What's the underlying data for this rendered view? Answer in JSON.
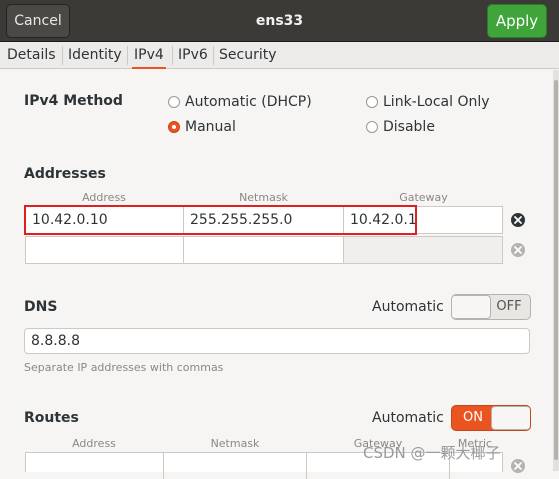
{
  "header": {
    "title": "ens33",
    "cancel_label": "Cancel",
    "apply_label": "Apply",
    "apply_color": "#3fa53a"
  },
  "tabs": [
    {
      "label": "Details",
      "active": false
    },
    {
      "label": "Identity",
      "active": false
    },
    {
      "label": "IPv4",
      "active": true
    },
    {
      "label": "IPv6",
      "active": false
    },
    {
      "label": "Security",
      "active": false
    }
  ],
  "ipv4_method": {
    "label": "IPv4 Method",
    "options": [
      {
        "label": "Automatic (DHCP)",
        "selected": false
      },
      {
        "label": "Link-Local Only",
        "selected": false
      },
      {
        "label": "Manual",
        "selected": true
      },
      {
        "label": "Disable",
        "selected": false
      }
    ]
  },
  "addresses": {
    "label": "Addresses",
    "columns": [
      "Address",
      "Netmask",
      "Gateway"
    ],
    "rows": [
      {
        "address": "10.42.0.10",
        "netmask": "255.255.255.0",
        "gateway": "10.42.0.1"
      },
      {
        "address": "",
        "netmask": "",
        "gateway": ""
      }
    ]
  },
  "dns": {
    "label": "DNS",
    "auto_label": "Automatic",
    "switch_label": "OFF",
    "switch_on": false,
    "value": "8.8.8.8",
    "hint": "Separate IP addresses with commas"
  },
  "routes": {
    "label": "Routes",
    "auto_label": "Automatic",
    "switch_label": "ON",
    "switch_on": true,
    "columns": [
      "Address",
      "Netmask",
      "Gateway",
      "Metric"
    ]
  },
  "accent_color": "#e95420",
  "watermark": "CSDN @一颗大椰子"
}
